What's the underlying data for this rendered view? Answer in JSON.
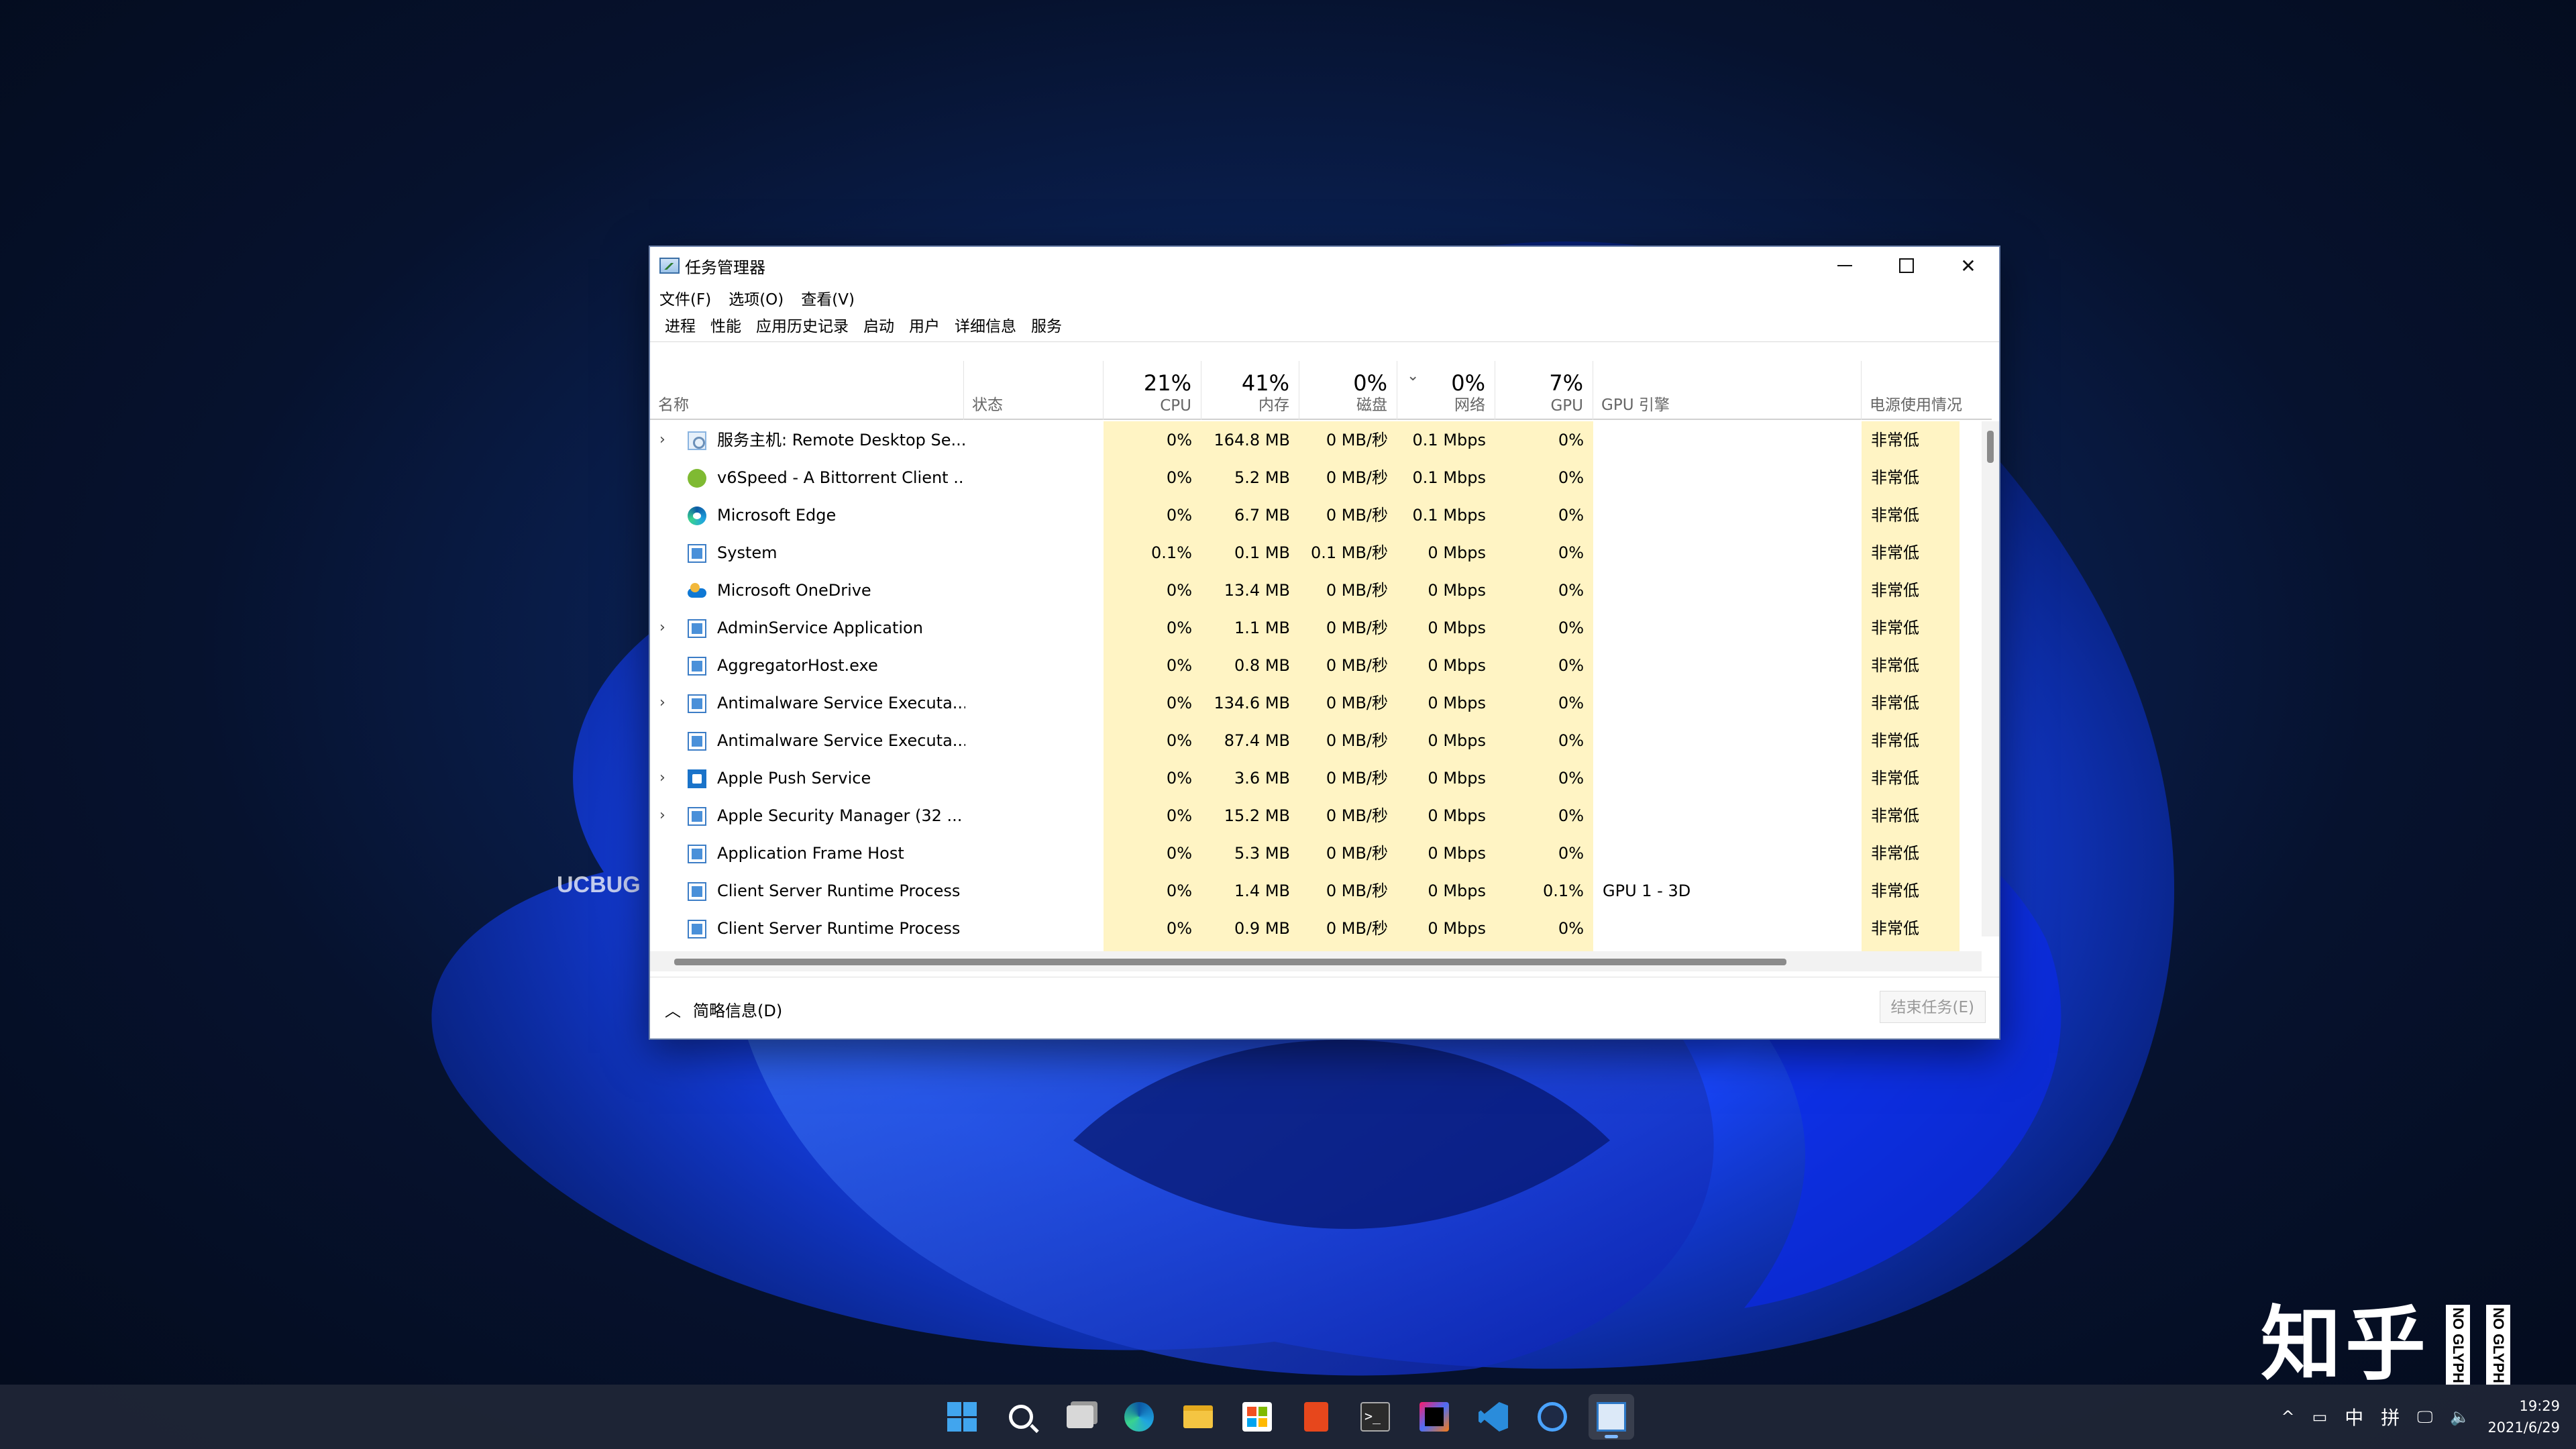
{
  "window": {
    "title": "任务管理器",
    "controls": {
      "minimize": "—",
      "close": "✕"
    }
  },
  "menu": [
    "文件(F)",
    "选项(O)",
    "查看(V)"
  ],
  "tabs": [
    "进程",
    "性能",
    "应用历史记录",
    "启动",
    "用户",
    "详细信息",
    "服务"
  ],
  "active_tab": "进程",
  "columns": {
    "name": {
      "label": "名称"
    },
    "status": {
      "label": "状态"
    },
    "cpu": {
      "pct": "21%",
      "label": "CPU"
    },
    "memory": {
      "pct": "41%",
      "label": "内存"
    },
    "disk": {
      "pct": "0%",
      "label": "磁盘"
    },
    "network": {
      "pct": "0%",
      "label": "网络",
      "sort_indicator": "⌄"
    },
    "gpu": {
      "pct": "7%",
      "label": "GPU"
    },
    "gpu_engine": {
      "label": "GPU 引擎"
    },
    "power": {
      "label": "电源使用情况"
    }
  },
  "processes": [
    {
      "expander": "›",
      "icon": "service-host-icon",
      "name": "服务主机: Remote Desktop Se...",
      "cpu": "0%",
      "memory": "164.8 MB",
      "disk": "0 MB/秒",
      "network": "0.1 Mbps",
      "gpu": "0%",
      "gpu_engine": "",
      "power": "非常低"
    },
    {
      "expander": "",
      "icon": "v6speed-icon",
      "name": "v6Speed - A Bittorrent Client ...",
      "cpu": "0%",
      "memory": "5.2 MB",
      "disk": "0 MB/秒",
      "network": "0.1 Mbps",
      "gpu": "0%",
      "gpu_engine": "",
      "power": "非常低"
    },
    {
      "expander": "",
      "icon": "edge-icon",
      "name": "Microsoft Edge",
      "cpu": "0%",
      "memory": "6.7 MB",
      "disk": "0 MB/秒",
      "network": "0.1 Mbps",
      "gpu": "0%",
      "gpu_engine": "",
      "power": "非常低"
    },
    {
      "expander": "",
      "icon": "system-icon",
      "name": "System",
      "cpu": "0.1%",
      "memory": "0.1 MB",
      "disk": "0.1 MB/秒",
      "network": "0 Mbps",
      "gpu": "0%",
      "gpu_engine": "",
      "power": "非常低"
    },
    {
      "expander": "",
      "icon": "onedrive-icon",
      "name": "Microsoft OneDrive",
      "cpu": "0%",
      "memory": "13.4 MB",
      "disk": "0 MB/秒",
      "network": "0 Mbps",
      "gpu": "0%",
      "gpu_engine": "",
      "power": "非常低"
    },
    {
      "expander": "›",
      "icon": "app-icon",
      "name": "AdminService Application",
      "cpu": "0%",
      "memory": "1.1 MB",
      "disk": "0 MB/秒",
      "network": "0 Mbps",
      "gpu": "0%",
      "gpu_engine": "",
      "power": "非常低"
    },
    {
      "expander": "",
      "icon": "app-icon",
      "name": "AggregatorHost.exe",
      "cpu": "0%",
      "memory": "0.8 MB",
      "disk": "0 MB/秒",
      "network": "0 Mbps",
      "gpu": "0%",
      "gpu_engine": "",
      "power": "非常低"
    },
    {
      "expander": "›",
      "icon": "app-icon",
      "name": "Antimalware Service Executa...",
      "cpu": "0%",
      "memory": "134.6 MB",
      "disk": "0 MB/秒",
      "network": "0 Mbps",
      "gpu": "0%",
      "gpu_engine": "",
      "power": "非常低"
    },
    {
      "expander": "",
      "icon": "app-icon",
      "name": "Antimalware Service Executa...",
      "cpu": "0%",
      "memory": "87.4 MB",
      "disk": "0 MB/秒",
      "network": "0 Mbps",
      "gpu": "0%",
      "gpu_engine": "",
      "power": "非常低"
    },
    {
      "expander": "›",
      "icon": "apple-push-icon",
      "name": "Apple Push Service",
      "cpu": "0%",
      "memory": "3.6 MB",
      "disk": "0 MB/秒",
      "network": "0 Mbps",
      "gpu": "0%",
      "gpu_engine": "",
      "power": "非常低"
    },
    {
      "expander": "›",
      "icon": "app-icon",
      "name": "Apple Security Manager (32 ...",
      "cpu": "0%",
      "memory": "15.2 MB",
      "disk": "0 MB/秒",
      "network": "0 Mbps",
      "gpu": "0%",
      "gpu_engine": "",
      "power": "非常低"
    },
    {
      "expander": "",
      "icon": "app-icon",
      "name": "Application Frame Host",
      "cpu": "0%",
      "memory": "5.3 MB",
      "disk": "0 MB/秒",
      "network": "0 Mbps",
      "gpu": "0%",
      "gpu_engine": "",
      "power": "非常低"
    },
    {
      "expander": "",
      "icon": "app-icon",
      "name": "Client Server Runtime Process",
      "cpu": "0%",
      "memory": "1.4 MB",
      "disk": "0 MB/秒",
      "network": "0 Mbps",
      "gpu": "0.1%",
      "gpu_engine": "GPU 1 - 3D",
      "power": "非常低"
    },
    {
      "expander": "",
      "icon": "app-icon",
      "name": "Client Server Runtime Process",
      "cpu": "0%",
      "memory": "0.9 MB",
      "disk": "0 MB/秒",
      "network": "0 Mbps",
      "gpu": "0%",
      "gpu_engine": "",
      "power": "非常低"
    }
  ],
  "footer": {
    "fewer_details": "简略信息(D)",
    "fewer_chevron": "︿",
    "end_task": "结束任务(E)"
  },
  "watermarks": {
    "ucbug": "UCBUG",
    "zhihu": "知乎",
    "noglyph": "NO GLYPH"
  },
  "taskbar": {
    "apps": [
      "start-icon",
      "search-icon",
      "task-view-icon",
      "edge-icon",
      "file-explorer-icon",
      "store-icon",
      "office-icon",
      "terminal-icon",
      "jetbrains-icon",
      "vscode-icon",
      "browser-icon",
      "task-manager-icon"
    ],
    "active_app": "task-manager-icon",
    "tray": {
      "chevron": "^",
      "ime_lang": "中",
      "ime_mode": "拼"
    },
    "clock": {
      "time": "19:29",
      "date": "2021/6/29"
    }
  },
  "colors": {
    "heat_cell": "#fff4c4",
    "accent": "#0067c0",
    "taskbar": "#202636"
  }
}
